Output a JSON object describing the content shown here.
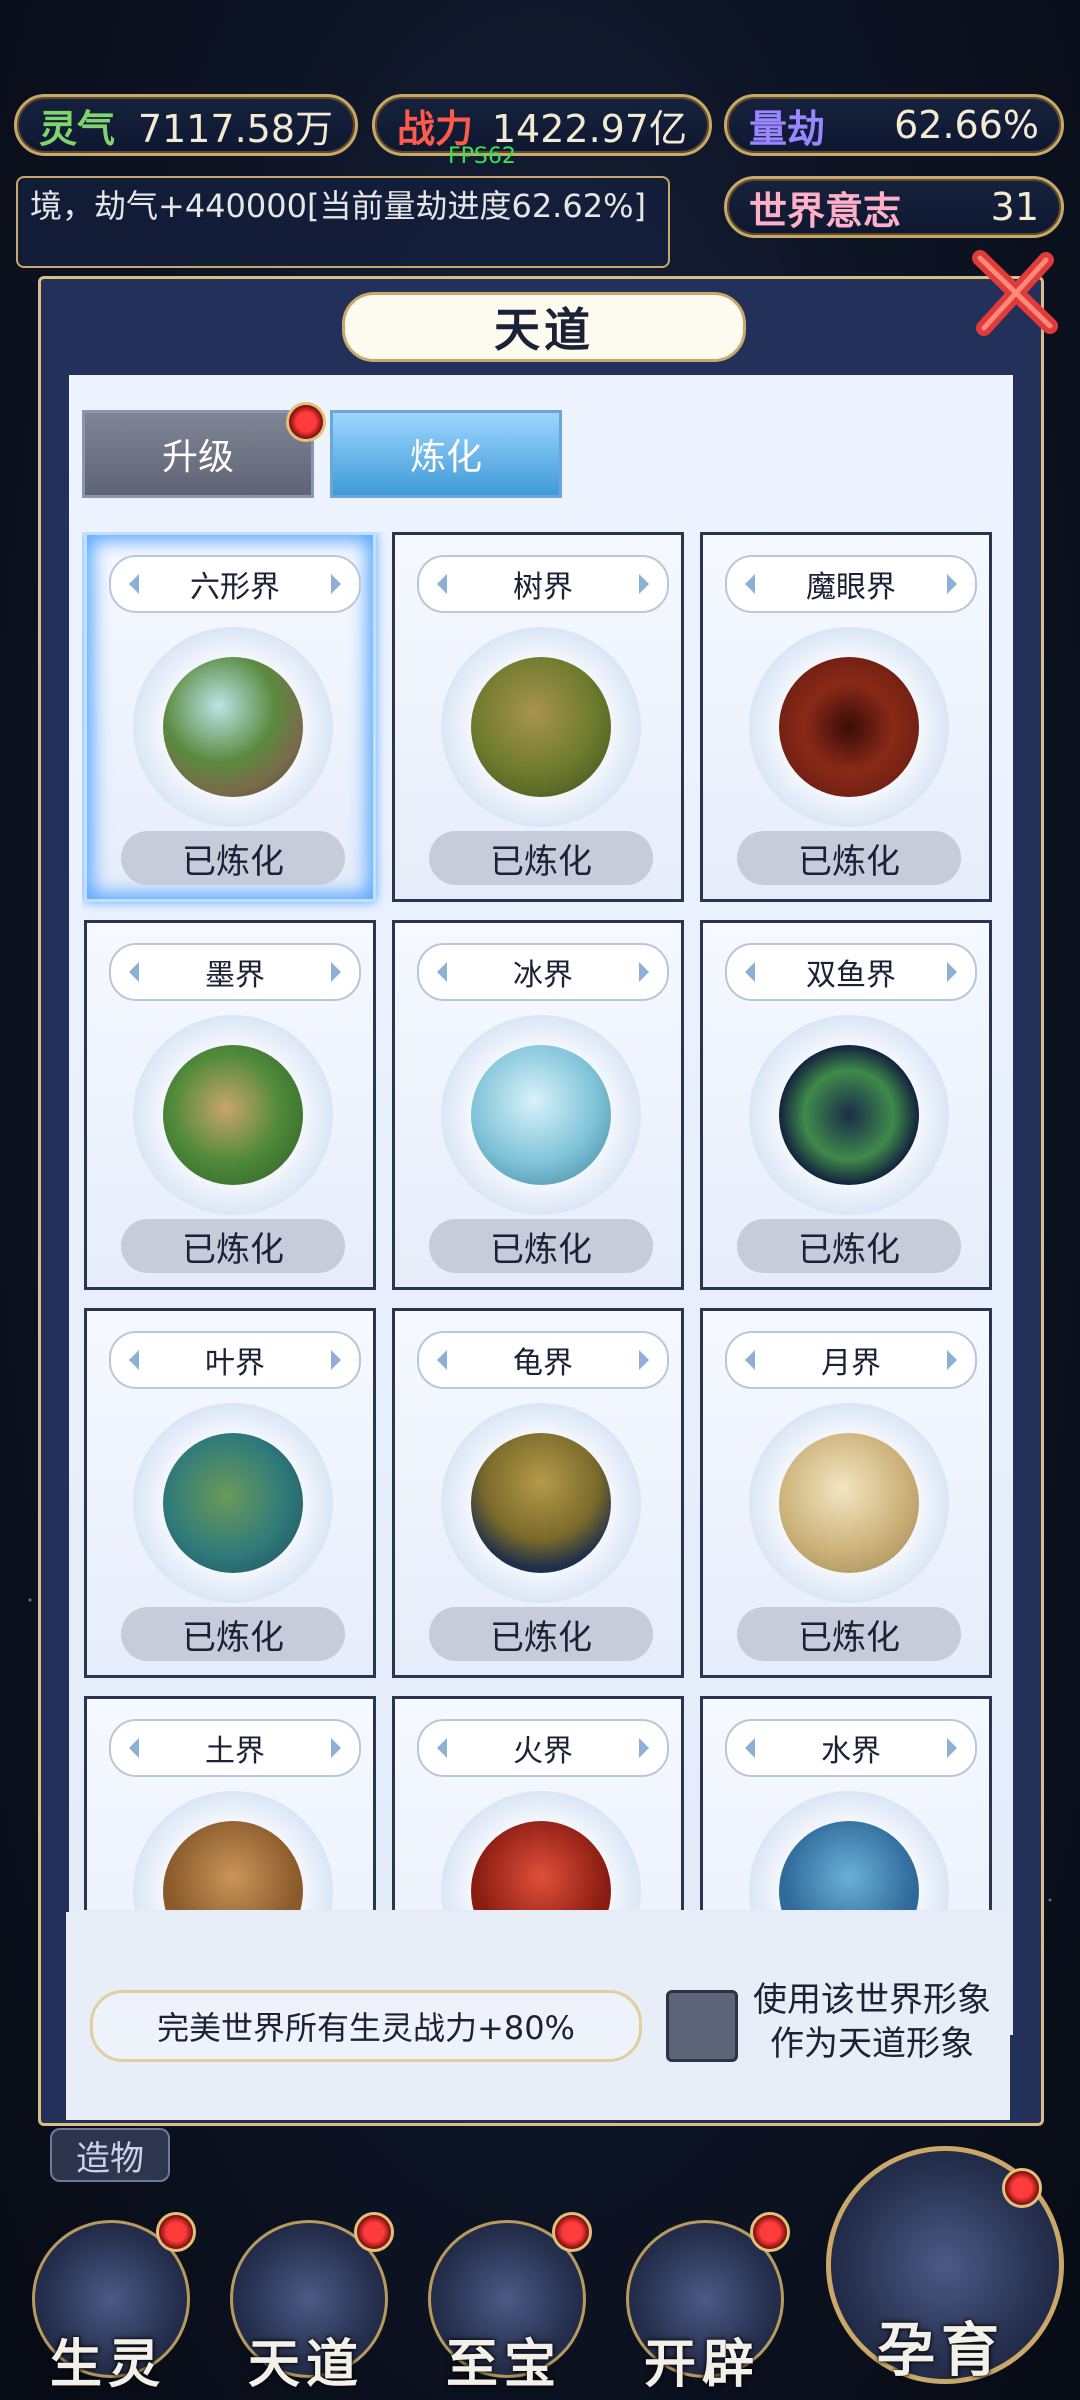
{
  "header": {
    "lingqi": {
      "label": "灵气",
      "value": "7117.58万"
    },
    "zhanli": {
      "label": "战力",
      "value": "1422.97亿"
    },
    "liangjie": {
      "label": "量劫",
      "value": "62.66%"
    },
    "shijie": {
      "label": "世界意志",
      "value": "31"
    },
    "fps": "FPS62",
    "log": "境，劫气+440000[当前量劫进度62.62%]"
  },
  "modal": {
    "title": "天道",
    "tabs": [
      {
        "label": "升级"
      },
      {
        "label": "炼化"
      }
    ],
    "cards": [
      {
        "name": "六形界",
        "status": "已炼化"
      },
      {
        "name": "树界",
        "status": "已炼化"
      },
      {
        "name": "魔眼界",
        "status": "已炼化"
      },
      {
        "name": "墨界",
        "status": "已炼化"
      },
      {
        "name": "冰界",
        "status": "已炼化"
      },
      {
        "name": "双鱼界",
        "status": "已炼化"
      },
      {
        "name": "叶界",
        "status": "已炼化"
      },
      {
        "name": "龟界",
        "status": "已炼化"
      },
      {
        "name": "月界",
        "status": "已炼化"
      },
      {
        "name": "土界",
        "status": ""
      },
      {
        "name": "火界",
        "status": ""
      },
      {
        "name": "水界",
        "status": ""
      }
    ],
    "bonus": "完美世界所有生灵战力+80%",
    "checkbox_label": "使用该世界形象作为天道形象"
  },
  "bottom": {
    "zaowu": "造物",
    "nav": [
      {
        "label": "生灵"
      },
      {
        "label": "天道"
      },
      {
        "label": "至宝"
      },
      {
        "label": "开辟"
      },
      {
        "label": "孕育"
      }
    ]
  },
  "colors": {
    "accent_gold": "#c9a86a",
    "selected_tab": "#3f9ad8",
    "red_dot": "#ff3b3b"
  }
}
